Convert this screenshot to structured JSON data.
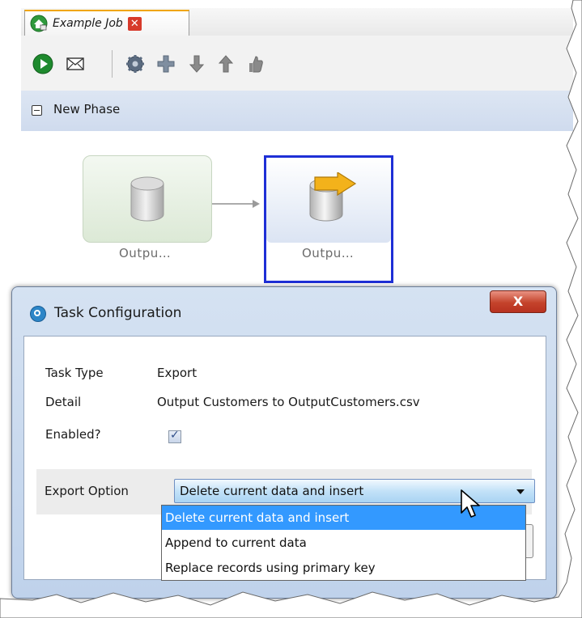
{
  "tab": {
    "title": "Example Job",
    "icon": "job-icon",
    "close_icon": "close-x-icon"
  },
  "toolbar": {
    "buttons": [
      {
        "name": "run-icon"
      },
      {
        "name": "email-icon"
      },
      {
        "name": "settings-gear-icon"
      },
      {
        "name": "add-icon"
      },
      {
        "name": "move-down-icon"
      },
      {
        "name": "move-up-icon"
      },
      {
        "name": "thumb-icon"
      }
    ]
  },
  "phase": {
    "title": "New Phase",
    "toggle_icon": "collapse-minus-icon"
  },
  "nodes": [
    {
      "label": "Outpu…",
      "icon": "database-icon",
      "state": "disabled"
    },
    {
      "label": "Outpu…",
      "icon": "database-export-icon",
      "state": "selected"
    }
  ],
  "dialog": {
    "title": "Task Configuration",
    "close_label": "X",
    "task_type_label": "Task Type",
    "task_type_value": "Export",
    "detail_label": "Detail",
    "detail_value": "Output Customers to OutputCustomers.csv",
    "enabled_label": "Enabled?",
    "enabled_checked": true,
    "export_option_label": "Export Option",
    "export_option_value": "Delete current data and insert",
    "options": [
      "Delete current data and insert",
      "Append to current data",
      "Replace records using primary key"
    ],
    "selected_option_index": 0
  },
  "colors": {
    "accent_tab": "#f0a500",
    "selection_border": "#1e2fd6",
    "dropdown_highlight": "#3399ff",
    "close_button": "#c4432b",
    "run_icon": "#1e8a2e"
  }
}
